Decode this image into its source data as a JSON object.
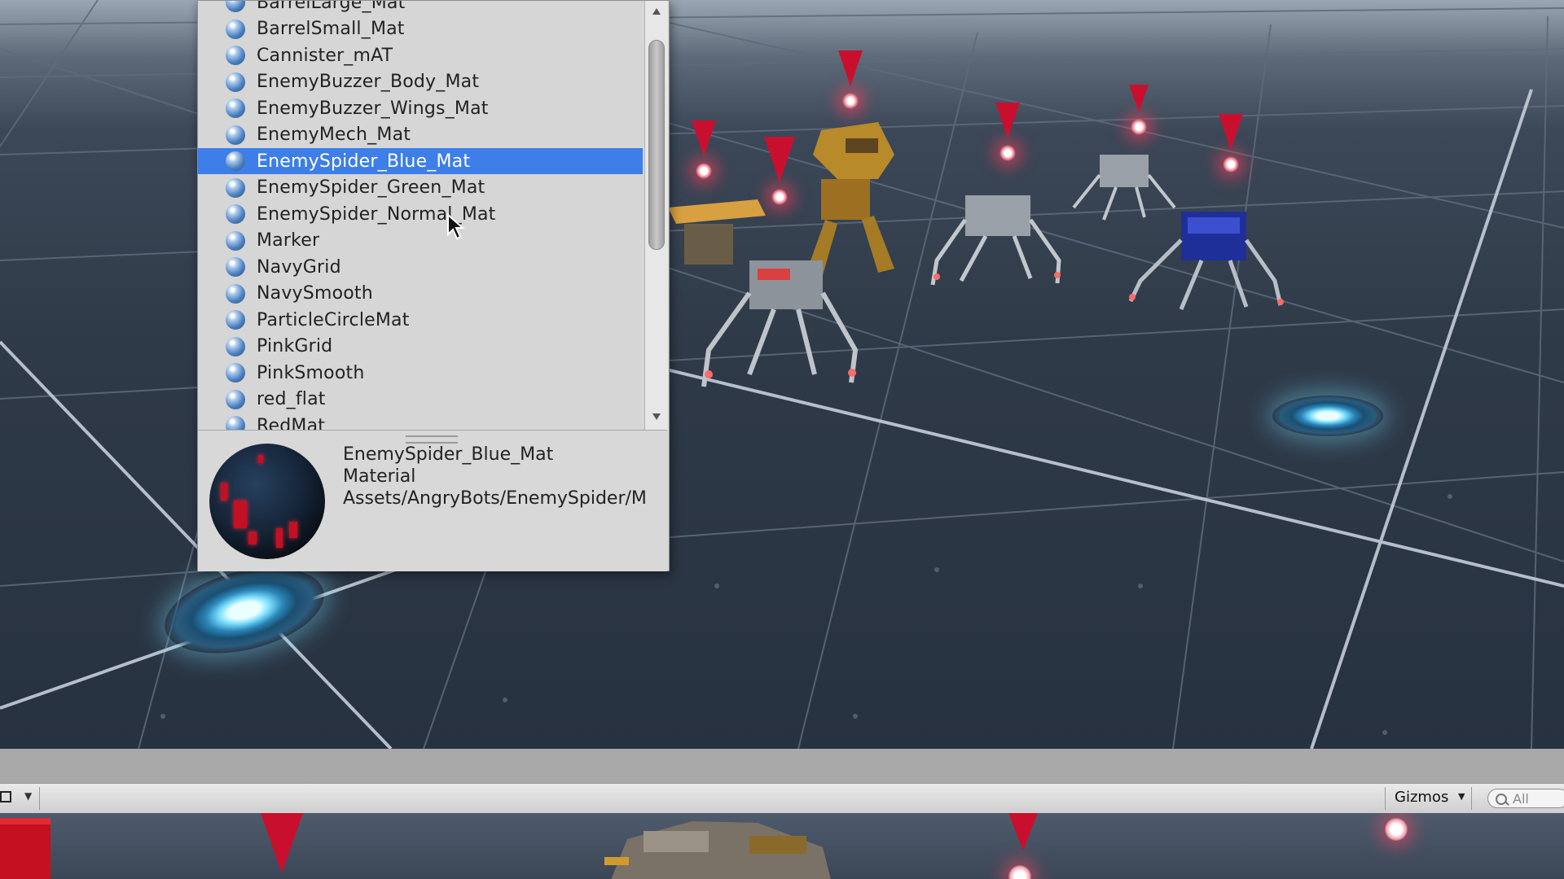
{
  "popup": {
    "items": [
      {
        "label": "BarrelLarge_Mat",
        "selected": false
      },
      {
        "label": "BarrelSmall_Mat",
        "selected": false
      },
      {
        "label": "Cannister_mAT",
        "selected": false
      },
      {
        "label": "EnemyBuzzer_Body_Mat",
        "selected": false
      },
      {
        "label": "EnemyBuzzer_Wings_Mat",
        "selected": false
      },
      {
        "label": "EnemyMech_Mat",
        "selected": false
      },
      {
        "label": "EnemySpider_Blue_Mat",
        "selected": true
      },
      {
        "label": "EnemySpider_Green_Mat",
        "selected": false
      },
      {
        "label": "EnemySpider_Normal_Mat",
        "selected": false
      },
      {
        "label": "Marker",
        "selected": false
      },
      {
        "label": "NavyGrid",
        "selected": false
      },
      {
        "label": "NavySmooth",
        "selected": false
      },
      {
        "label": "ParticleCircleMat",
        "selected": false
      },
      {
        "label": "PinkGrid",
        "selected": false
      },
      {
        "label": "PinkSmooth",
        "selected": false
      },
      {
        "label": "red_flat",
        "selected": false
      },
      {
        "label": "RedMat",
        "selected": false
      }
    ],
    "scroll_up_icon": "triangle-up-icon",
    "scroll_down_icon": "triangle-down-icon",
    "preview": {
      "name": "EnemySpider_Blue_Mat",
      "type": "Material",
      "path": "Assets/AngryBots/EnemySpider/M"
    }
  },
  "toolbar": {
    "gizmos_label": "Gizmos",
    "search_placeholder": "All"
  },
  "colors": {
    "selection": "#3d7ee8",
    "marker_red": "#c8102e",
    "popup_bg": "#d6d6d6"
  }
}
